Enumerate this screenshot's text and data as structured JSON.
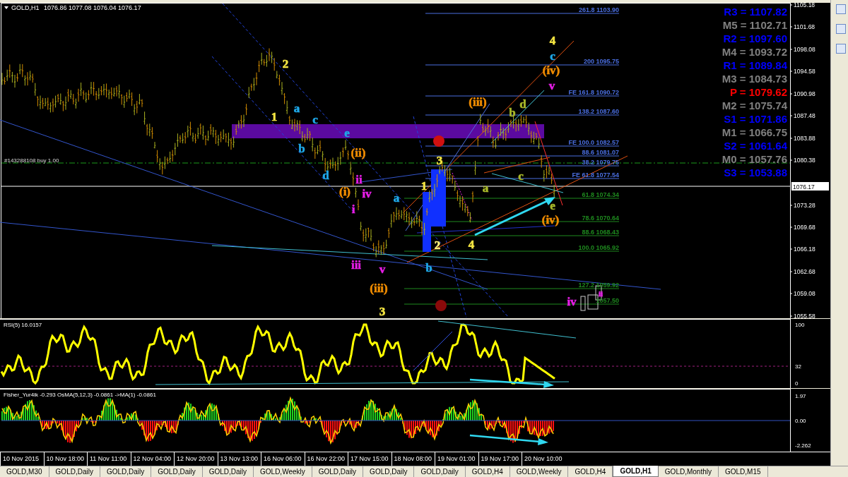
{
  "chart_header": {
    "symbol": "GOLD,H1",
    "prices": "1076.86 1077.08 1076.04 1076.17"
  },
  "order_label": "#143288108 buy 1.00",
  "pivot_levels": [
    {
      "text": "R3 = 1107.82",
      "color": "#0000ff"
    },
    {
      "text": "M5 = 1102.71",
      "color": "#808080"
    },
    {
      "text": "R2 = 1097.60",
      "color": "#0000ff"
    },
    {
      "text": "M4 = 1093.72",
      "color": "#808080"
    },
    {
      "text": "R1 = 1089.84",
      "color": "#0000ff"
    },
    {
      "text": "M3 = 1084.73",
      "color": "#808080"
    },
    {
      "text": "P  = 1079.62",
      "color": "#ff0000"
    },
    {
      "text": "M2 = 1075.74",
      "color": "#808080"
    },
    {
      "text": "S1 = 1071.86",
      "color": "#0000ff"
    },
    {
      "text": "M1 = 1066.75",
      "color": "#808080"
    },
    {
      "text": "S2 = 1061.64",
      "color": "#0000ff"
    },
    {
      "text": "M0 = 1057.76",
      "color": "#808080"
    },
    {
      "text": "S3 = 1053.88",
      "color": "#0000ff"
    }
  ],
  "fib_labels": [
    {
      "text": "261.8  1103.90",
      "color": "#4a6ee0"
    },
    {
      "text": "200  1095.75",
      "color": "#4a6ee0"
    },
    {
      "text": "FE 161.8  1090.72",
      "color": "#4a6ee0"
    },
    {
      "text": "138.2  1087.60",
      "color": "#4a6ee0"
    },
    {
      "text": "FE 100.0  1082.57",
      "color": "#4a6ee0"
    },
    {
      "text": "88.6  1081.07",
      "color": "#4a6ee0"
    },
    {
      "text": "38.2  1079.75",
      "color": "#4a6ee0"
    },
    {
      "text": "FE 61.8  1077.54",
      "color": "#4a6ee0"
    },
    {
      "text": "61.8  1074.34",
      "color": "#1e8a1e"
    },
    {
      "text": "78.6  1070.64",
      "color": "#1e8a1e"
    },
    {
      "text": "88.6  1068.43",
      "color": "#1e8a1e"
    },
    {
      "text": "100.0  1065.92",
      "color": "#1e8a1e"
    },
    {
      "text": "127.2  1059.92",
      "color": "#1e8a1e"
    },
    {
      "text": "1057.50",
      "color": "#1e8a1e"
    }
  ],
  "wave_labels": [
    {
      "text": "4",
      "color": "#f5e642"
    },
    {
      "text": "c",
      "color": "#1fa8e8"
    },
    {
      "text": "2",
      "color": "#f5e642"
    },
    {
      "text": "(iv)",
      "color": "#f08c00"
    },
    {
      "text": "v",
      "color": "#e61ee6"
    },
    {
      "text": "(iii)",
      "color": "#f08c00"
    },
    {
      "text": "d",
      "color": "#a8b82a"
    },
    {
      "text": "a",
      "color": "#1fa8e8"
    },
    {
      "text": "b",
      "color": "#a8b82a"
    },
    {
      "text": "1",
      "color": "#f5e642"
    },
    {
      "text": "c",
      "color": "#1fa8e8"
    },
    {
      "text": "e",
      "color": "#1fa8e8"
    },
    {
      "text": "b",
      "color": "#1fa8e8"
    },
    {
      "text": "(ii)",
      "color": "#f08c00"
    },
    {
      "text": "3",
      "color": "#f5e642"
    },
    {
      "text": "d",
      "color": "#1fa8e8"
    },
    {
      "text": "ii",
      "color": "#e61ee6"
    },
    {
      "text": "c",
      "color": "#a8b82a"
    },
    {
      "text": "(i)",
      "color": "#f08c00"
    },
    {
      "text": "iv",
      "color": "#e61ee6"
    },
    {
      "text": "a",
      "color": "#1fa8e8"
    },
    {
      "text": "1",
      "color": "#f5e642"
    },
    {
      "text": "a",
      "color": "#a8b82a"
    },
    {
      "text": "i",
      "color": "#e61ee6"
    },
    {
      "text": "e",
      "color": "#a8b82a"
    },
    {
      "text": "(iv)",
      "color": "#f08c00"
    },
    {
      "text": "2",
      "color": "#fff27a"
    },
    {
      "text": "4",
      "color": "#f5e642"
    },
    {
      "text": "iii",
      "color": "#e61ee6"
    },
    {
      "text": "v",
      "color": "#e61ee6"
    },
    {
      "text": "b",
      "color": "#1fa8e8"
    },
    {
      "text": "(iii)",
      "color": "#f08c00"
    },
    {
      "text": "iv",
      "color": "#e61ee6"
    },
    {
      "text": "ii",
      "color": "#e61ee6"
    },
    {
      "text": "3",
      "color": "#f5e642"
    }
  ],
  "price_axis": {
    "ticks": [
      "1105.18",
      "1101.68",
      "1098.08",
      "1094.58",
      "1090.98",
      "1087.48",
      "1083.88",
      "1080.38",
      "1073.28",
      "1069.68",
      "1066.18",
      "1062.68",
      "1059.08",
      "1055.58"
    ],
    "current_price": "1076.17"
  },
  "rsi_pane": {
    "title": "RSI(5) 16.0157",
    "ticks": [
      "100",
      "32",
      "0"
    ]
  },
  "fisher_pane": {
    "title": "Fisher_Yur4ik -0.293  OsMA(5,12,3) -0.0861  ->MA(1) -0.0861",
    "ticks": [
      "1.97",
      "0.00",
      "-2.262"
    ]
  },
  "time_axis": [
    "10 Nov 2015",
    "10 Nov 18:00",
    "11 Nov 11:00",
    "12 Nov 04:00",
    "12 Nov 20:00",
    "13 Nov 13:00",
    "16 Nov 06:00",
    "16 Nov 22:00",
    "17 Nov 15:00",
    "18 Nov 08:00",
    "19 Nov 01:00",
    "19 Nov 17:00",
    "20 Nov 10:00"
  ],
  "tabs": [
    {
      "label": "GOLD,M30",
      "selected": false
    },
    {
      "label": "GOLD,Daily",
      "selected": false
    },
    {
      "label": "GOLD,Daily",
      "selected": false
    },
    {
      "label": "GOLD,Daily",
      "selected": false
    },
    {
      "label": "GOLD,Daily",
      "selected": false
    },
    {
      "label": "GOLD,Weekly",
      "selected": false
    },
    {
      "label": "GOLD,Daily",
      "selected": false
    },
    {
      "label": "GOLD,Daily",
      "selected": false
    },
    {
      "label": "GOLD,Daily",
      "selected": false
    },
    {
      "label": "GOLD,H4",
      "selected": false
    },
    {
      "label": "GOLD,Weekly",
      "selected": false
    },
    {
      "label": "GOLD,H4",
      "selected": false
    },
    {
      "label": "GOLD,H1",
      "selected": true
    },
    {
      "label": "GOLD,Monthly",
      "selected": false
    },
    {
      "label": "GOLD,M15",
      "selected": false
    }
  ]
}
